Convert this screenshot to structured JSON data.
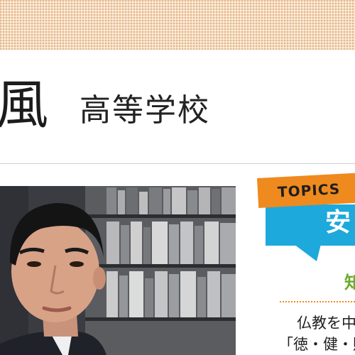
{
  "header": {
    "school_kanji": "風",
    "school_type": "高等学校"
  },
  "topics": {
    "label": "TOPICS",
    "bubble_text": "安",
    "heading_fragment": "知",
    "body_line_1": "仏教を中",
    "body_line_2": "「徳・健・財"
  },
  "colors": {
    "topics_orange": "#ef8a1f",
    "bubble_blue": "#1ea9dc",
    "heading_green": "#6aab2c"
  }
}
